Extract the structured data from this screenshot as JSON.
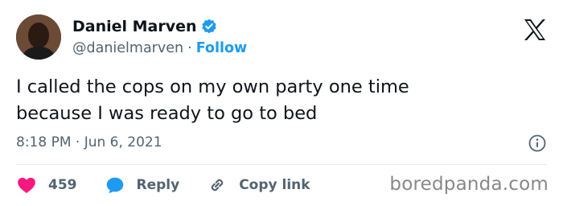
{
  "author": {
    "name": "Daniel Marven",
    "handle": "@danielmarven",
    "separator": "·",
    "follow_label": "Follow",
    "verified": true
  },
  "tweet": {
    "line1": "I called the cops on my own party one time",
    "line2": "because I was ready to go to bed",
    "timestamp": "8:18 PM · Jun 6, 2021"
  },
  "actions": {
    "like_count": "459",
    "reply_label": "Reply",
    "copy_label": "Copy link"
  },
  "watermark": "boredpanda.com",
  "colors": {
    "text": "#0f1419",
    "secondary": "#536471",
    "link": "#1d9bf0",
    "like": "#f91880",
    "reply": "#1d9bf0"
  }
}
